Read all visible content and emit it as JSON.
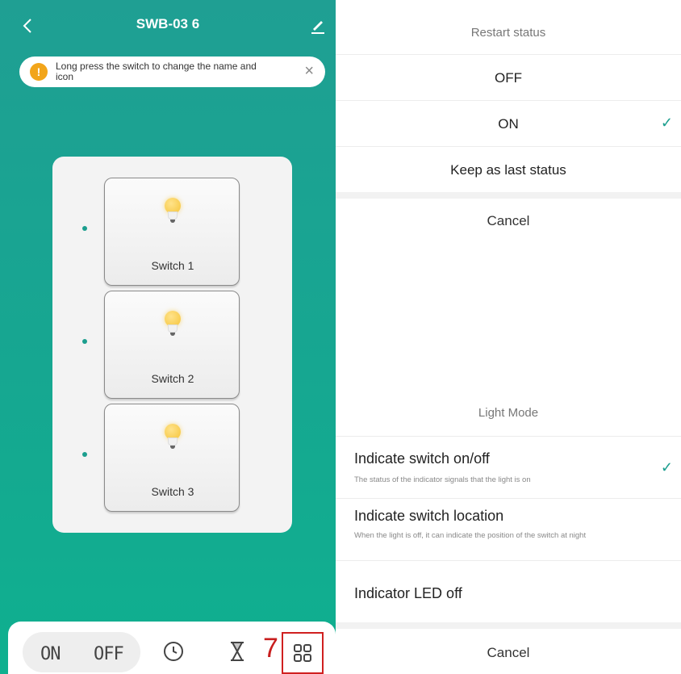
{
  "left": {
    "title": "SWB-03 6",
    "tip": "Long press the switch to change the name and icon",
    "switches": [
      {
        "label": "Switch 1"
      },
      {
        "label": "Switch 2"
      },
      {
        "label": "Switch 3"
      }
    ],
    "bottom": {
      "on_label": "ON",
      "off_label": "OFF",
      "annotation_number": "7"
    }
  },
  "restart_sheet": {
    "title": "Restart status",
    "options": [
      {
        "label": "OFF",
        "selected": false
      },
      {
        "label": "ON",
        "selected": true
      },
      {
        "label": "Keep as last status",
        "selected": false
      }
    ],
    "cancel": "Cancel"
  },
  "light_sheet": {
    "title": "Light Mode",
    "options": [
      {
        "label": "Indicate switch on/off",
        "desc": "The status of the indicator signals that the light is on",
        "selected": true
      },
      {
        "label": "Indicate switch location",
        "desc": "When the light is off, it can indicate the position of the switch at night",
        "selected": false
      },
      {
        "label": "Indicator LED off",
        "desc": "",
        "selected": false
      }
    ],
    "cancel": "Cancel"
  },
  "colors": {
    "accent": "#1b9e8e",
    "warning": "#f2a51a",
    "annotation": "#d02020"
  }
}
